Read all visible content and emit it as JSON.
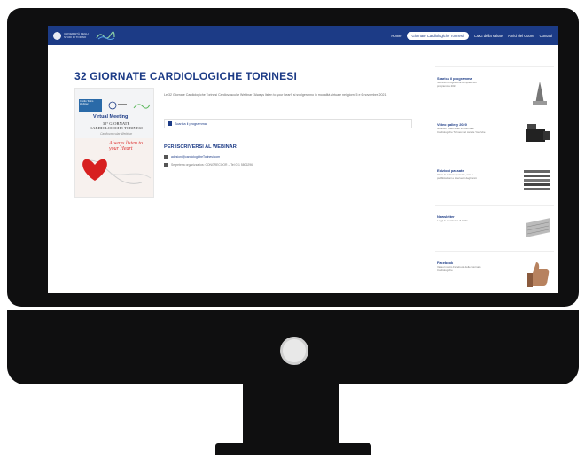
{
  "nav": {
    "brand": "UNIVERSITÀ DEGLI STUDI DI TORINO",
    "links": [
      "Home",
      "Giornate Cardiologiche Torinesi",
      "CMG della salute",
      "Amici del Cuore",
      "Contatti"
    ],
    "active_index": 1
  },
  "main": {
    "title": "32 GIORNATE CARDIOLOGICHE TORINESI",
    "intro": "Le 32 Giornate Cardiologiche Torinesi Cardiovascular Webinar \"Always listen to your heart\" si svolgeranno in modalità virtuale nei giorni 5 e 6 novembre 2021.",
    "program_label": "Scarica il programma",
    "signup_title": "PER ISCRIVERSI AL WEBINAR",
    "email": "adesioni@cardiologicheTorinesi.com",
    "phone": "Segreteria organizzativa: CONGRECOOR – Tel 011 5806296"
  },
  "poster": {
    "tag": "Cardio Torino Webinar",
    "virtual": "Virtual Meeting",
    "title_line1": "32° GIORNATE",
    "title_line2": "CARDIOLOGICHE TORINESI",
    "subtitle": "Cardiovascular Webinar",
    "script_text": "Always listen to your Heart"
  },
  "sidebar": [
    {
      "title": "Scarica il programma",
      "desc": "Scarica il programma completo del programma 2021"
    },
    {
      "title": "Video gallery 2020",
      "desc": "Guarda i video delle 31 Giornate Cardiologiche Torinesi nel canale YouTube"
    },
    {
      "title": "Edizioni passate",
      "desc": "Visita la sezione passate, con le pubblicazioni e interventi degli anni"
    },
    {
      "title": "Newsletter",
      "desc": "Leggi le newsletter di CMG"
    },
    {
      "title": "Facebook",
      "desc": "Vai sul nostro Facebook delle Giornate Cardiologiche"
    }
  ],
  "colors": {
    "navy": "#1c3b86",
    "bezel": "#0f0f10",
    "heart": "#d33"
  }
}
